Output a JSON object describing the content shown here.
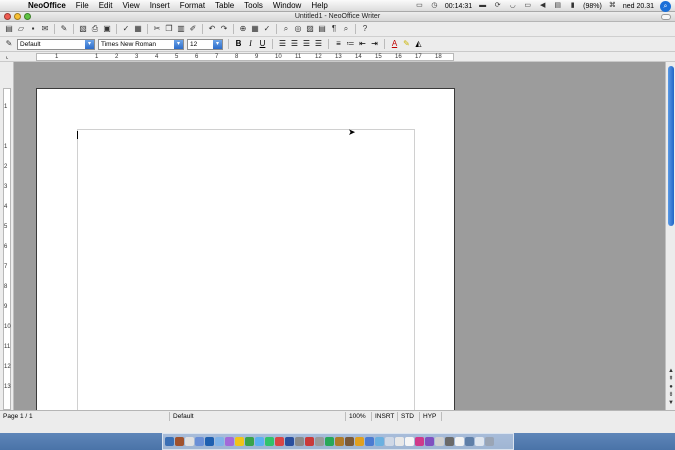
{
  "menubar": {
    "app_name": "NeoOffice",
    "items": [
      "File",
      "Edit",
      "View",
      "Insert",
      "Format",
      "Table",
      "Tools",
      "Window",
      "Help"
    ],
    "clock": "00:14:31",
    "battery": "(98%)",
    "datetime": "ned 20.31"
  },
  "window": {
    "title": "Untitled1 - NeoOffice Writer"
  },
  "format": {
    "style": "Default",
    "font": "Times New Roman",
    "size": "12"
  },
  "ruler": {
    "h_labels": [
      "1",
      "1",
      "2",
      "3",
      "4",
      "5",
      "6",
      "7",
      "8",
      "9",
      "10",
      "11",
      "12",
      "13",
      "14",
      "15",
      "16",
      "17",
      "18"
    ],
    "v_labels": [
      "1",
      "1",
      "2",
      "3",
      "4",
      "5",
      "6",
      "7",
      "8",
      "9",
      "10",
      "11",
      "12",
      "13"
    ]
  },
  "status": {
    "page": "Page 1 / 1",
    "style": "Default",
    "zoom": "100%",
    "insert": "INSRT",
    "std": "STD",
    "hyp": "HYP"
  },
  "colors": {
    "accent": "#2c6cc9",
    "desktop": "#5d86b3",
    "close": "#ef5b51",
    "minimize": "#f7bf33",
    "zoom": "#5fc343"
  }
}
